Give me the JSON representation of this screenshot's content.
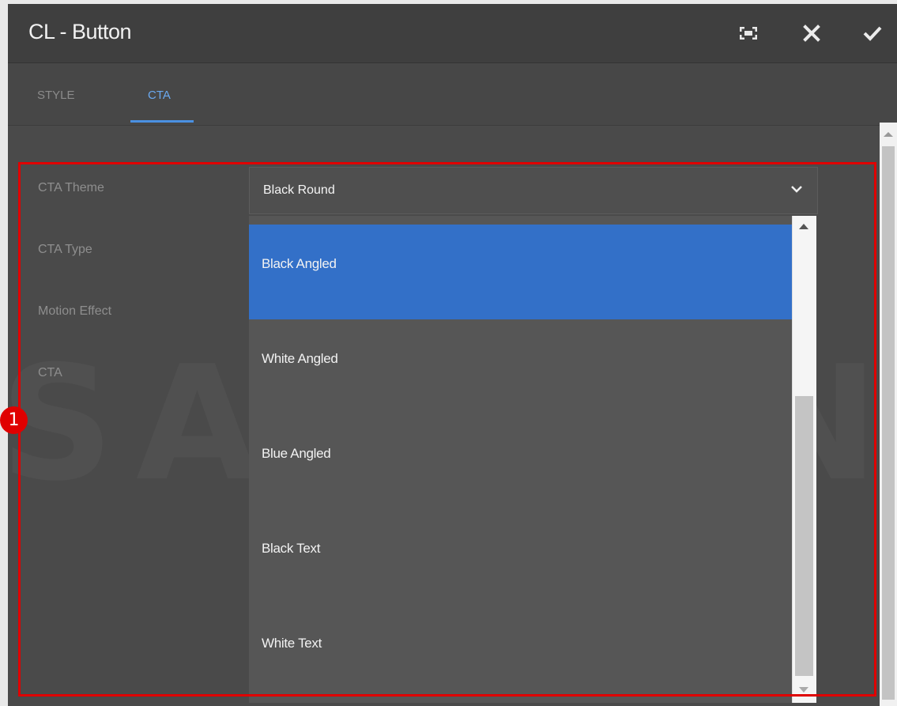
{
  "dialog": {
    "title": "CL - Button"
  },
  "tabs": [
    {
      "label": "STYLE",
      "active": false
    },
    {
      "label": "CTA",
      "active": true
    }
  ],
  "fields": {
    "cta_theme": "CTA Theme",
    "cta_type": "CTA Type",
    "motion_effect": "Motion Effect",
    "cta": "CTA"
  },
  "select": {
    "value": "Black Round"
  },
  "options": [
    {
      "label": "Black Angled",
      "selected": true
    },
    {
      "label": "White Angled",
      "selected": false
    },
    {
      "label": "Blue Angled",
      "selected": false
    },
    {
      "label": "Black Text",
      "selected": false
    },
    {
      "label": "White Text",
      "selected": false
    }
  ],
  "watermark": {
    "brand": "SAMSUNG"
  },
  "annotation": {
    "marker": "1"
  },
  "colors": {
    "accent_blue": "#3370c8",
    "tab_active": "#6aa9f0",
    "highlight_red": "#e00000"
  }
}
